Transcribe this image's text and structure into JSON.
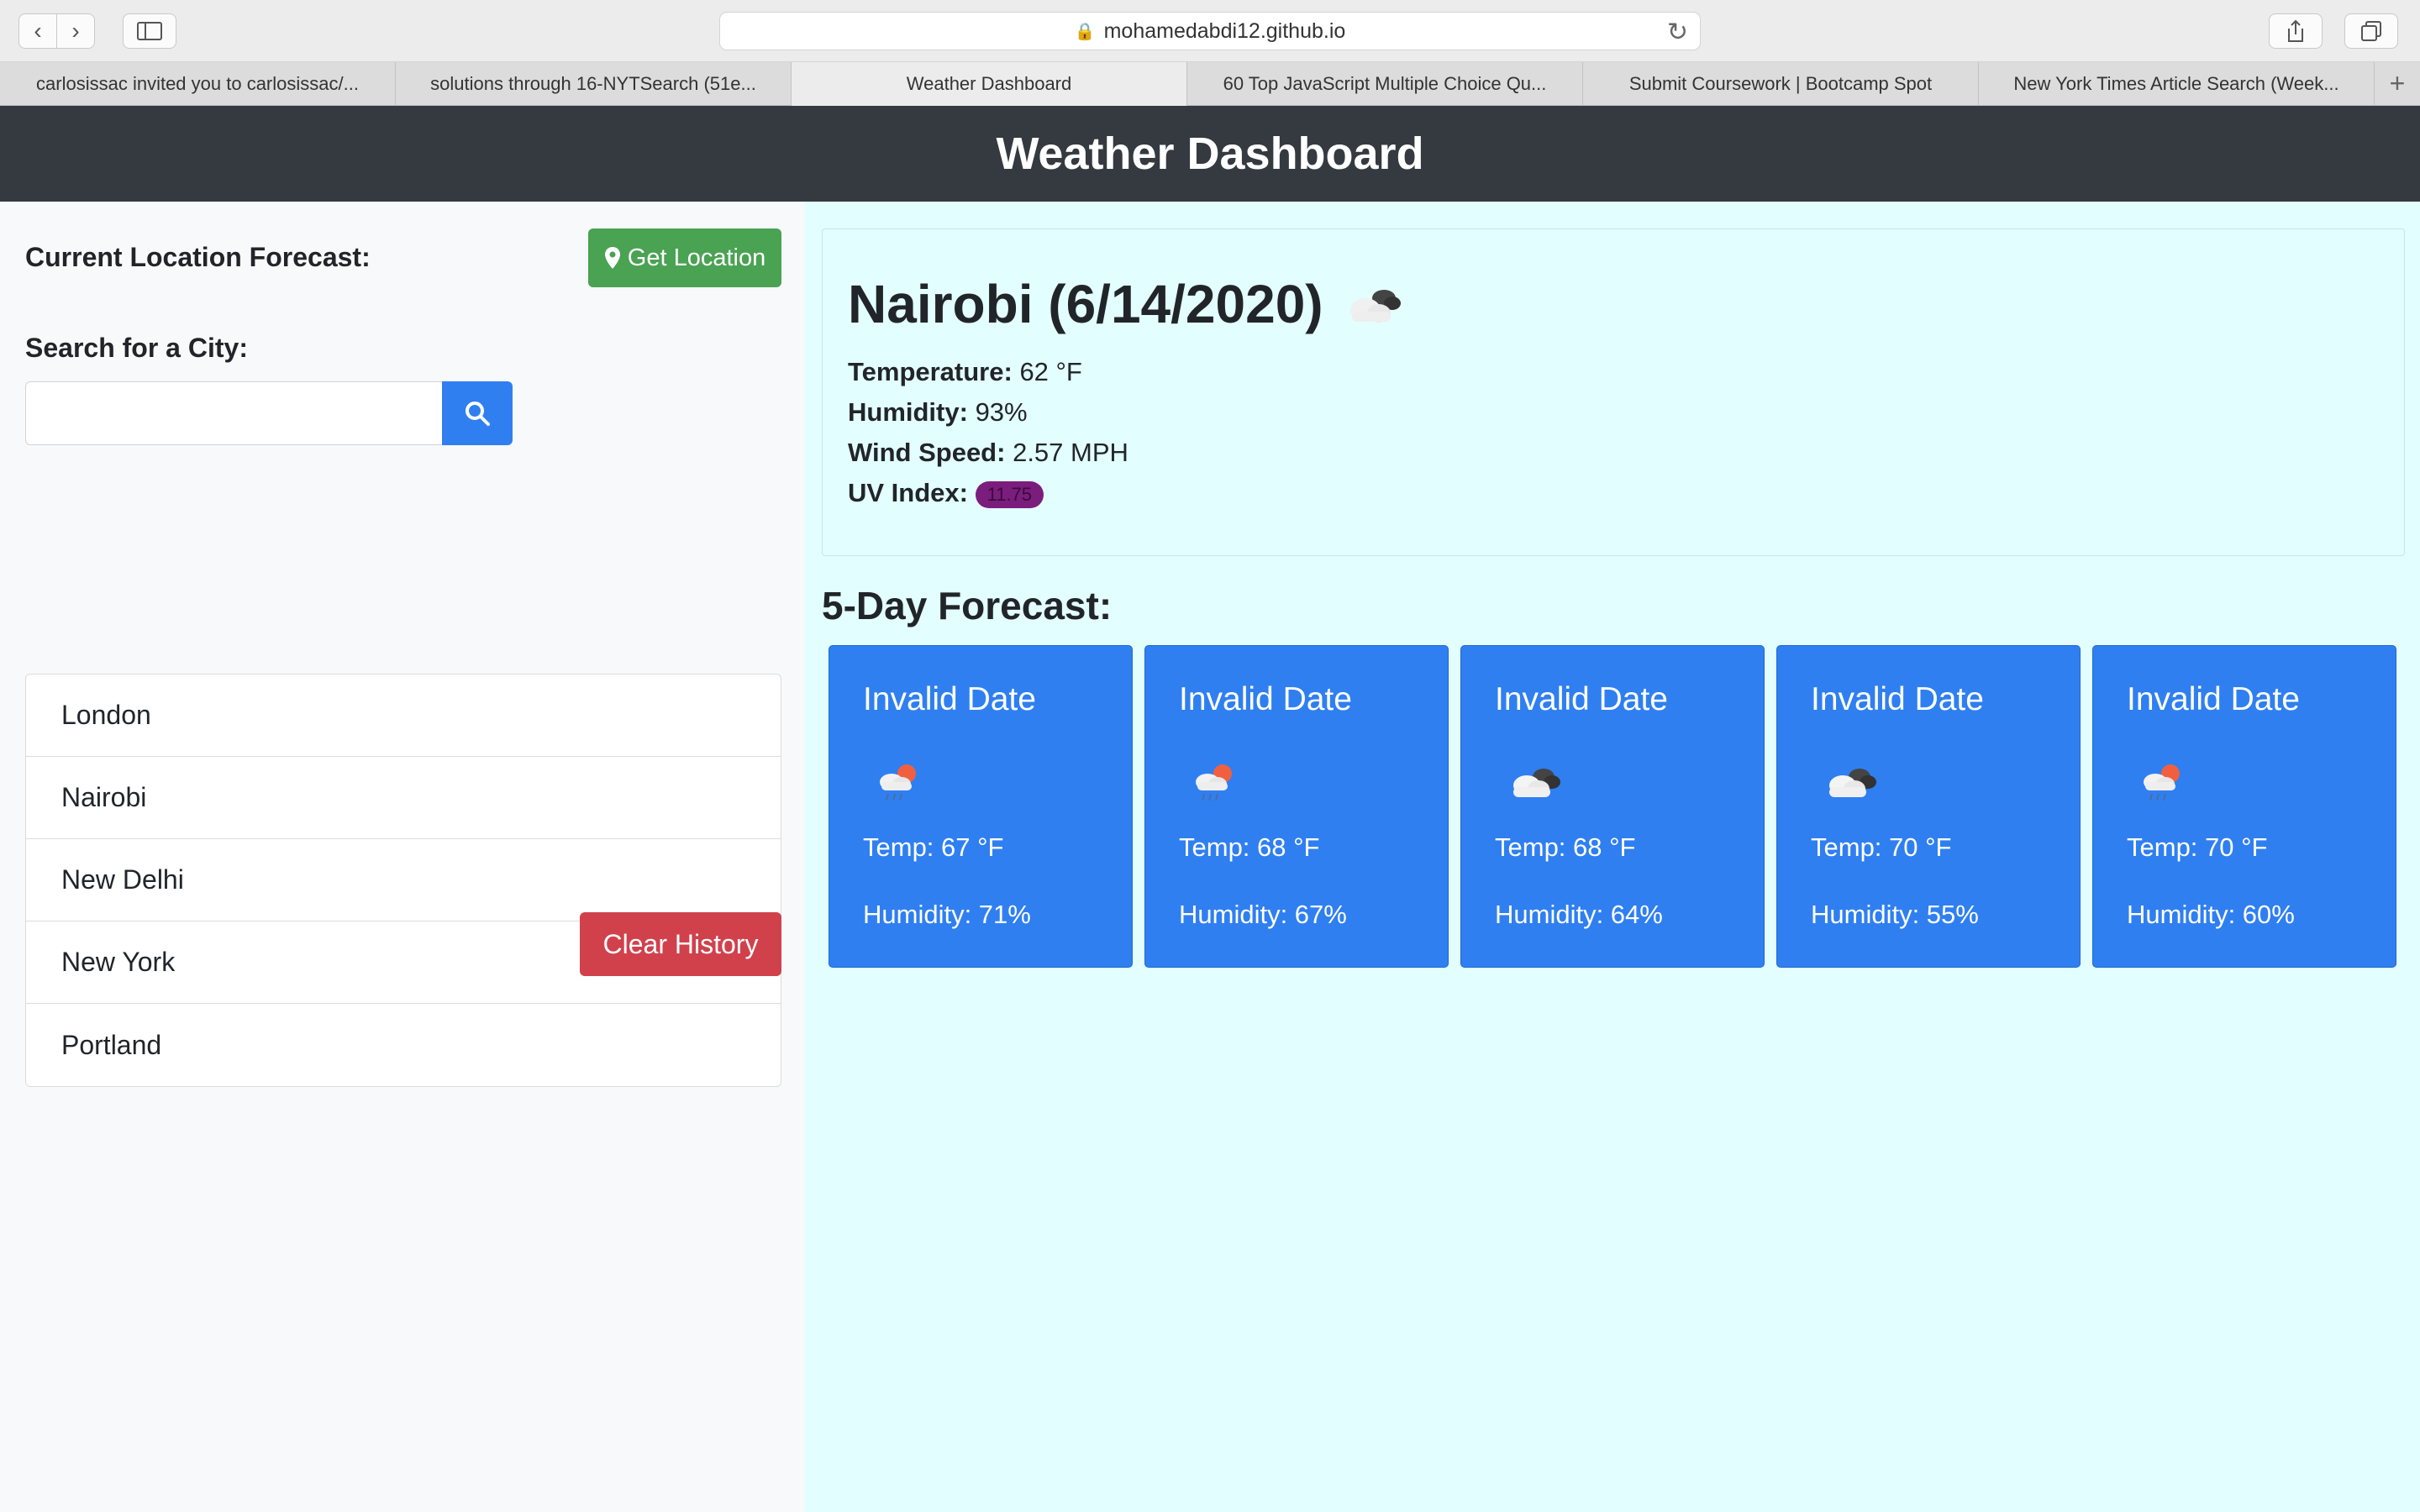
{
  "browser": {
    "url": "mohamedabdi12.github.io",
    "tabs": [
      {
        "label": "carlosissac invited you to carlosissac/..."
      },
      {
        "label": "solutions through 16-NYTSearch (51e..."
      },
      {
        "label": "Weather Dashboard"
      },
      {
        "label": "60 Top JavaScript Multiple Choice Qu..."
      },
      {
        "label": "Submit Coursework | Bootcamp Spot"
      },
      {
        "label": "New York Times Article Search (Week..."
      }
    ]
  },
  "header": {
    "title": "Weather Dashboard"
  },
  "sidebar": {
    "current_label": "Current Location Forecast:",
    "get_location": "Get Location",
    "search_label": "Search for a City:",
    "search_value": "",
    "cities": [
      "London",
      "Nairobi",
      "New Delhi",
      "New York",
      "Portland"
    ],
    "clear_history": "Clear History"
  },
  "current": {
    "title": "Nairobi (6/14/2020)",
    "icon": "cloudy-icon",
    "temperature_label": "Temperature:",
    "temperature": "62 °F",
    "humidity_label": "Humidity:",
    "humidity": "93%",
    "wind_label": "Wind Speed:",
    "wind": "2.57 MPH",
    "uv_label": "UV Index:",
    "uv": "11.75",
    "uv_color": "#7b1d7c"
  },
  "forecast": {
    "title": "5-Day Forecast:",
    "days": [
      {
        "date": "Invalid Date",
        "icon": "rain-sun-icon",
        "temp": "Temp: 67 °F",
        "humidity": "Humidity: 71%"
      },
      {
        "date": "Invalid Date",
        "icon": "rain-sun-icon",
        "temp": "Temp: 68 °F",
        "humidity": "Humidity: 67%"
      },
      {
        "date": "Invalid Date",
        "icon": "cloudy-icon",
        "temp": "Temp: 68 °F",
        "humidity": "Humidity: 64%"
      },
      {
        "date": "Invalid Date",
        "icon": "cloudy-icon",
        "temp": "Temp: 70 °F",
        "humidity": "Humidity: 55%"
      },
      {
        "date": "Invalid Date",
        "icon": "rain-sun-icon",
        "temp": "Temp: 70 °F",
        "humidity": "Humidity: 60%"
      }
    ]
  },
  "colors": {
    "header_bg": "#343a40",
    "primary": "#2f7ff1",
    "success": "#4aa253",
    "danger": "#d0414c",
    "panel_bg": "#e3feff"
  }
}
